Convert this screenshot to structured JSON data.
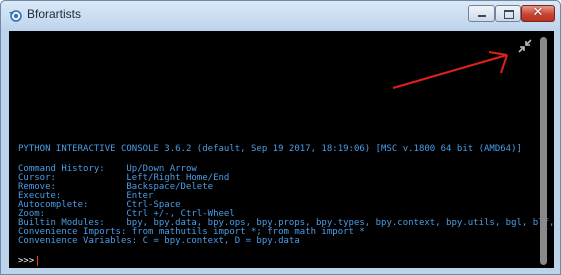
{
  "window": {
    "title": "Bforartists",
    "controls": [
      "minimize",
      "maximize",
      "close"
    ],
    "close_glyph": "✕"
  },
  "console": {
    "header": "PYTHON INTERACTIVE CONSOLE 3.6.2 (default, Sep 19 2017, 18:19:06) [MSC v.1800 64 bit (AMD64)]",
    "lines": [
      "Command History:    Up/Down Arrow",
      "Cursor:             Left/Right Home/End",
      "Remove:             Backspace/Delete",
      "Execute:            Enter",
      "Autocomplete:       Ctrl-Space",
      "Zoom:               Ctrl +/-, Ctrl-Wheel",
      "Builtin Modules:    bpy, bpy.data, bpy.ops, bpy.props, bpy.types, bpy.context, bpy.utils, bgl, blf, mathutils",
      "Convenience Imports: from mathutils import *; from math import *",
      "Convenience Variables: C = bpy.context, D = bpy.data"
    ],
    "prompt": ">>>"
  },
  "icons": {
    "app": "bforartists-app-icon",
    "collapse": "collapse-arrows-icon"
  },
  "colors": {
    "console_bg": "#000000",
    "console_text": "#4a9de8",
    "prompt_text": "#f2f2f2",
    "annotation_arrow": "#e0201a",
    "titlebar": "#c7daf0"
  }
}
